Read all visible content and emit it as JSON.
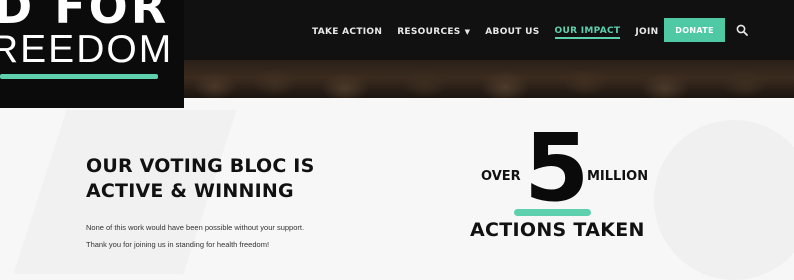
{
  "logo": {
    "line1": "D FOR",
    "line2": "REEDOM"
  },
  "nav": {
    "items": [
      {
        "label": "TAKE ACTION"
      },
      {
        "label": "RESOURCES"
      },
      {
        "label": "ABOUT US"
      },
      {
        "label": "OUR IMPACT"
      },
      {
        "label": "JOIN"
      }
    ],
    "active": "OUR IMPACT",
    "donate_label": "DONATE",
    "search_icon": "search-icon",
    "accent_color": "#5fd0ad"
  },
  "content": {
    "headline_line1": "OUR VOTING BLOC IS",
    "headline_line2": "ACTIVE & WINNING",
    "body_line1": "None of this work would have been possible without your support.",
    "body_line2": "Thank you for joining us in standing for health freedom!"
  },
  "stat": {
    "prefix": "OVER",
    "number": "5",
    "suffix": "MILLION",
    "label": "ACTIONS TAKEN"
  }
}
